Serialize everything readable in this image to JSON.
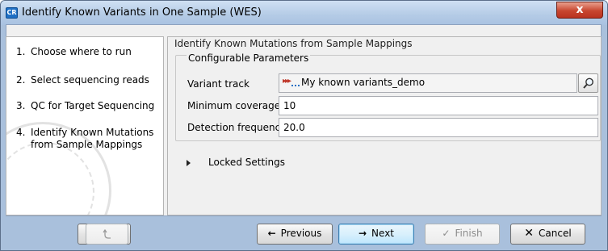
{
  "window": {
    "title": "Identify Known Variants in One Sample (WES)",
    "app_icon_text": "CR",
    "close_symbol": "x"
  },
  "steps": [
    {
      "num": "1.",
      "label": "Choose where to run"
    },
    {
      "num": "2.",
      "label": "Select sequencing reads"
    },
    {
      "num": "3.",
      "label": "QC for Target Sequencing"
    },
    {
      "num": "4.",
      "label": "Identify Known Mutations from Sample Mappings"
    }
  ],
  "panel": {
    "heading": "Identify Known Mutations from Sample Mappings",
    "group_title": "Configurable Parameters",
    "variant_track_label": "Variant track",
    "variant_track_value": "My known variants_demo",
    "min_coverage_label": "Minimum coverage",
    "min_coverage_value": "10",
    "detection_frequency_label": "Detection frequency",
    "detection_frequency_value": "20.0",
    "locked_settings_label": "Locked Settings"
  },
  "buttons": {
    "help": "?",
    "previous": "Previous",
    "next": "Next",
    "finish": "Finish",
    "cancel": "Cancel"
  },
  "colors": {
    "accent": "#3c7fb1",
    "title_bar": "#b4cbe6",
    "close_button": "#c8462f"
  }
}
